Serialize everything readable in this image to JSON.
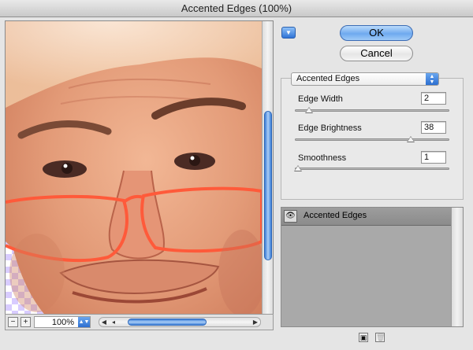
{
  "window": {
    "title": "Accented Edges (100%)"
  },
  "preview": {
    "zoom_out_label": "−",
    "zoom_in_label": "+",
    "zoom_value": "100%"
  },
  "buttons": {
    "ok": "OK",
    "cancel": "Cancel"
  },
  "filter": {
    "selected": "Accented Edges",
    "params": [
      {
        "label": "Edge Width",
        "value": "2",
        "min": 1,
        "max": 14
      },
      {
        "label": "Edge Brightness",
        "value": "38",
        "min": 0,
        "max": 50
      },
      {
        "label": "Smoothness",
        "value": "1",
        "min": 1,
        "max": 15
      }
    ]
  },
  "layers": [
    {
      "name": "Accented Edges",
      "visible": true
    }
  ],
  "icons": {
    "menu": "triangle-down-icon",
    "eye": "eye-icon",
    "new_layer": "new-layer-icon",
    "delete_layer": "trash-icon"
  },
  "colors": {
    "accent": "#3b82e0",
    "skin": "#e8a17c",
    "glasses": "#ff5a3a"
  }
}
